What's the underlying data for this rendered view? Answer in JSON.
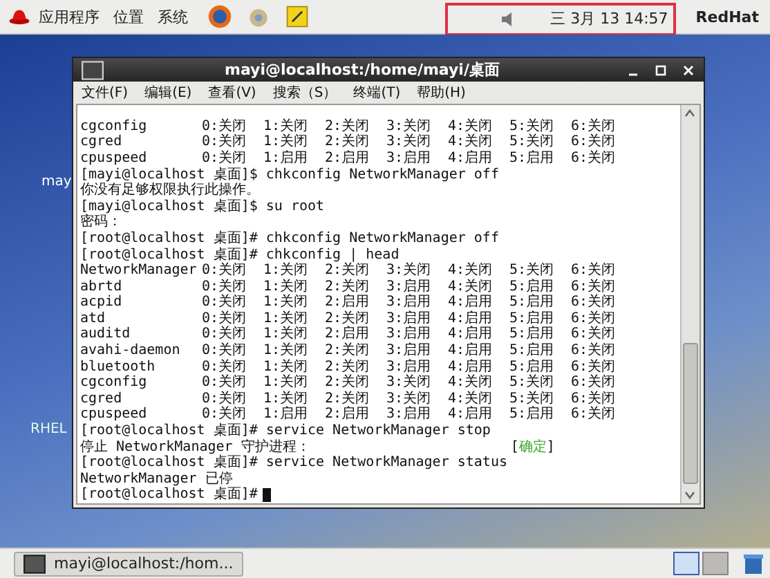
{
  "top_panel": {
    "menus": [
      "应用程序",
      "位置",
      "系统"
    ],
    "clock": "三 3月 13 14:57",
    "user": "RedHat"
  },
  "desktop": {
    "icons": [
      {
        "label": "may"
      },
      {
        "label": "RHEL"
      }
    ]
  },
  "window": {
    "title": "mayi@localhost:/home/mayi/桌面",
    "menu": [
      "文件(F)",
      "编辑(E)",
      "查看(V)",
      "搜索（S）",
      "终端(T)",
      "帮助(H)"
    ],
    "lines": [
      {
        "kind": "service",
        "name": "cgconfig",
        "cells": [
          "0:关闭",
          "1:关闭",
          "2:关闭",
          "3:关闭",
          "4:关闭",
          "5:关闭",
          "6:关闭"
        ]
      },
      {
        "kind": "service",
        "name": "cgred",
        "cells": [
          "0:关闭",
          "1:关闭",
          "2:关闭",
          "3:关闭",
          "4:关闭",
          "5:关闭",
          "6:关闭"
        ]
      },
      {
        "kind": "service",
        "name": "cpuspeed",
        "cells": [
          "0:关闭",
          "1:启用",
          "2:启用",
          "3:启用",
          "4:启用",
          "5:启用",
          "6:关闭"
        ]
      },
      {
        "kind": "text",
        "text": "[mayi@localhost 桌面]$ chkconfig NetworkManager off"
      },
      {
        "kind": "text",
        "text": "你没有足够权限执行此操作。"
      },
      {
        "kind": "text",
        "text": "[mayi@localhost 桌面]$ su root"
      },
      {
        "kind": "text",
        "text": "密码："
      },
      {
        "kind": "text",
        "text": "[root@localhost 桌面]# chkconfig NetworkManager off"
      },
      {
        "kind": "text",
        "text": "[root@localhost 桌面]# chkconfig | head"
      },
      {
        "kind": "service",
        "name": "NetworkManager",
        "cells": [
          "0:关闭",
          "1:关闭",
          "2:关闭",
          "3:关闭",
          "4:关闭",
          "5:关闭",
          "6:关闭"
        ]
      },
      {
        "kind": "service",
        "name": "abrtd",
        "cells": [
          "0:关闭",
          "1:关闭",
          "2:关闭",
          "3:启用",
          "4:关闭",
          "5:启用",
          "6:关闭"
        ]
      },
      {
        "kind": "service",
        "name": "acpid",
        "cells": [
          "0:关闭",
          "1:关闭",
          "2:启用",
          "3:启用",
          "4:启用",
          "5:启用",
          "6:关闭"
        ]
      },
      {
        "kind": "service",
        "name": "atd",
        "cells": [
          "0:关闭",
          "1:关闭",
          "2:关闭",
          "3:启用",
          "4:启用",
          "5:启用",
          "6:关闭"
        ]
      },
      {
        "kind": "service",
        "name": "auditd",
        "cells": [
          "0:关闭",
          "1:关闭",
          "2:启用",
          "3:启用",
          "4:启用",
          "5:启用",
          "6:关闭"
        ]
      },
      {
        "kind": "service",
        "name": "avahi-daemon",
        "cells": [
          "0:关闭",
          "1:关闭",
          "2:关闭",
          "3:启用",
          "4:启用",
          "5:启用",
          "6:关闭"
        ]
      },
      {
        "kind": "service",
        "name": "bluetooth",
        "cells": [
          "0:关闭",
          "1:关闭",
          "2:关闭",
          "3:启用",
          "4:启用",
          "5:启用",
          "6:关闭"
        ]
      },
      {
        "kind": "service",
        "name": "cgconfig",
        "cells": [
          "0:关闭",
          "1:关闭",
          "2:关闭",
          "3:关闭",
          "4:关闭",
          "5:关闭",
          "6:关闭"
        ]
      },
      {
        "kind": "service",
        "name": "cgred",
        "cells": [
          "0:关闭",
          "1:关闭",
          "2:关闭",
          "3:关闭",
          "4:关闭",
          "5:关闭",
          "6:关闭"
        ]
      },
      {
        "kind": "service",
        "name": "cpuspeed",
        "cells": [
          "0:关闭",
          "1:启用",
          "2:启用",
          "3:启用",
          "4:启用",
          "5:启用",
          "6:关闭"
        ]
      },
      {
        "kind": "text",
        "text": "[root@localhost 桌面]# service NetworkManager stop"
      },
      {
        "kind": "status",
        "text": "停止 NetworkManager 守护进程：",
        "open": "[",
        "word": "确定",
        "close": "]"
      },
      {
        "kind": "text",
        "text": "[root@localhost 桌面]# service NetworkManager status"
      },
      {
        "kind": "text",
        "text": "NetworkManager 已停"
      },
      {
        "kind": "prompt",
        "text": "[root@localhost 桌面]#",
        "cursor": true
      }
    ]
  },
  "taskbar": {
    "tasks": [
      {
        "label": "mayi@localhost:/hom...",
        "selected": false
      }
    ],
    "workspaces": [
      {
        "selected": true
      },
      {
        "selected": false
      }
    ]
  }
}
